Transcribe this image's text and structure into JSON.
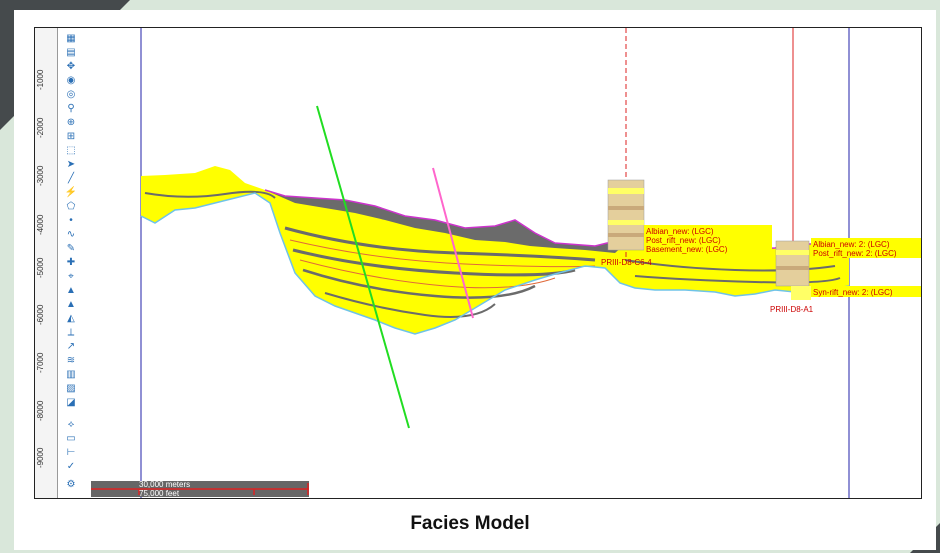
{
  "caption": "Facies Model",
  "depth_ticks": [
    "-1000",
    "-2000",
    "-3000",
    "-4000",
    "-5000",
    "-6000",
    "-7000",
    "-8000",
    "-9000"
  ],
  "scalebar": {
    "meters": "30,000 meters",
    "feet": "75,000 feet"
  },
  "well_labels": {
    "well1": "PRIII-D8-C6-4",
    "well2": "PRIII-D8-A1"
  },
  "horizon_labels_well1": [
    "Albian_new: (LGC)",
    "Post_rift_new: (LGC)",
    "Basement_new: (LGC)"
  ],
  "horizon_labels_well2": [
    "Albian_new: 2: (LGC)",
    "Post_rift_new: 2: (LGC)",
    "Syn-rift_new: 2: (LGC)"
  ],
  "colors": {
    "facies_yellow": "#ffff00",
    "facies_gray": "#6b6b6b",
    "top_horizon": "#cc33cc",
    "base_horizon": "#6fc3e8",
    "fault_green": "#22dd22",
    "fault_pink": "#ff66cc",
    "well_red": "#dd2222",
    "boundary_blue": "#2222aa"
  }
}
